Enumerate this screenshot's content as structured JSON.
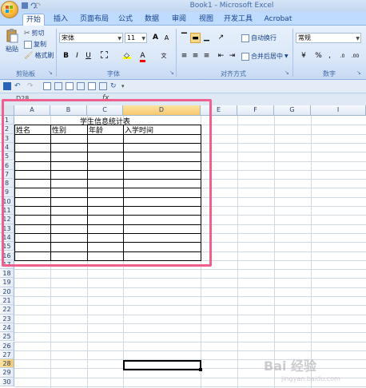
{
  "window": {
    "title": "Book1 - Microsoft Excel"
  },
  "tabs": [
    "开始",
    "插入",
    "页面布局",
    "公式",
    "数据",
    "审阅",
    "视图",
    "开发工具",
    "Acrobat"
  ],
  "clipboard": {
    "paste": "粘贴",
    "cut": "剪切",
    "copy": "复制",
    "format_painter": "格式刷",
    "label": "剪贴板"
  },
  "font": {
    "name": "宋体",
    "size": "11",
    "bold": "B",
    "italic": "I",
    "underline": "U",
    "grow": "A",
    "shrink": "A",
    "label": "字体"
  },
  "alignment": {
    "wrap_text": "自动换行",
    "merge_center": "合并后居中",
    "label": "对齐方式"
  },
  "number": {
    "format": "常规",
    "percent": "%",
    "comma": ",",
    "label": "数字"
  },
  "namebox": {
    "value": "D28"
  },
  "formula": {
    "fx": "fx"
  },
  "columns": [
    "A",
    "B",
    "C",
    "D",
    "E",
    "F",
    "G",
    "I"
  ],
  "rows": [
    "1",
    "2",
    "3",
    "4",
    "5",
    "6",
    "7",
    "8",
    "9",
    "10",
    "11",
    "12",
    "13",
    "14",
    "15",
    "16",
    "17",
    "18",
    "19",
    "20",
    "21",
    "22",
    "23",
    "24",
    "25",
    "26",
    "27",
    "28",
    "29",
    "30"
  ],
  "sheet": {
    "title": "学生信息统计表",
    "headers": [
      "姓名",
      "性别",
      "年龄",
      "入学时间"
    ]
  },
  "watermark": {
    "brand": "Bai 经验",
    "url": "jingyan.baidu.com"
  }
}
